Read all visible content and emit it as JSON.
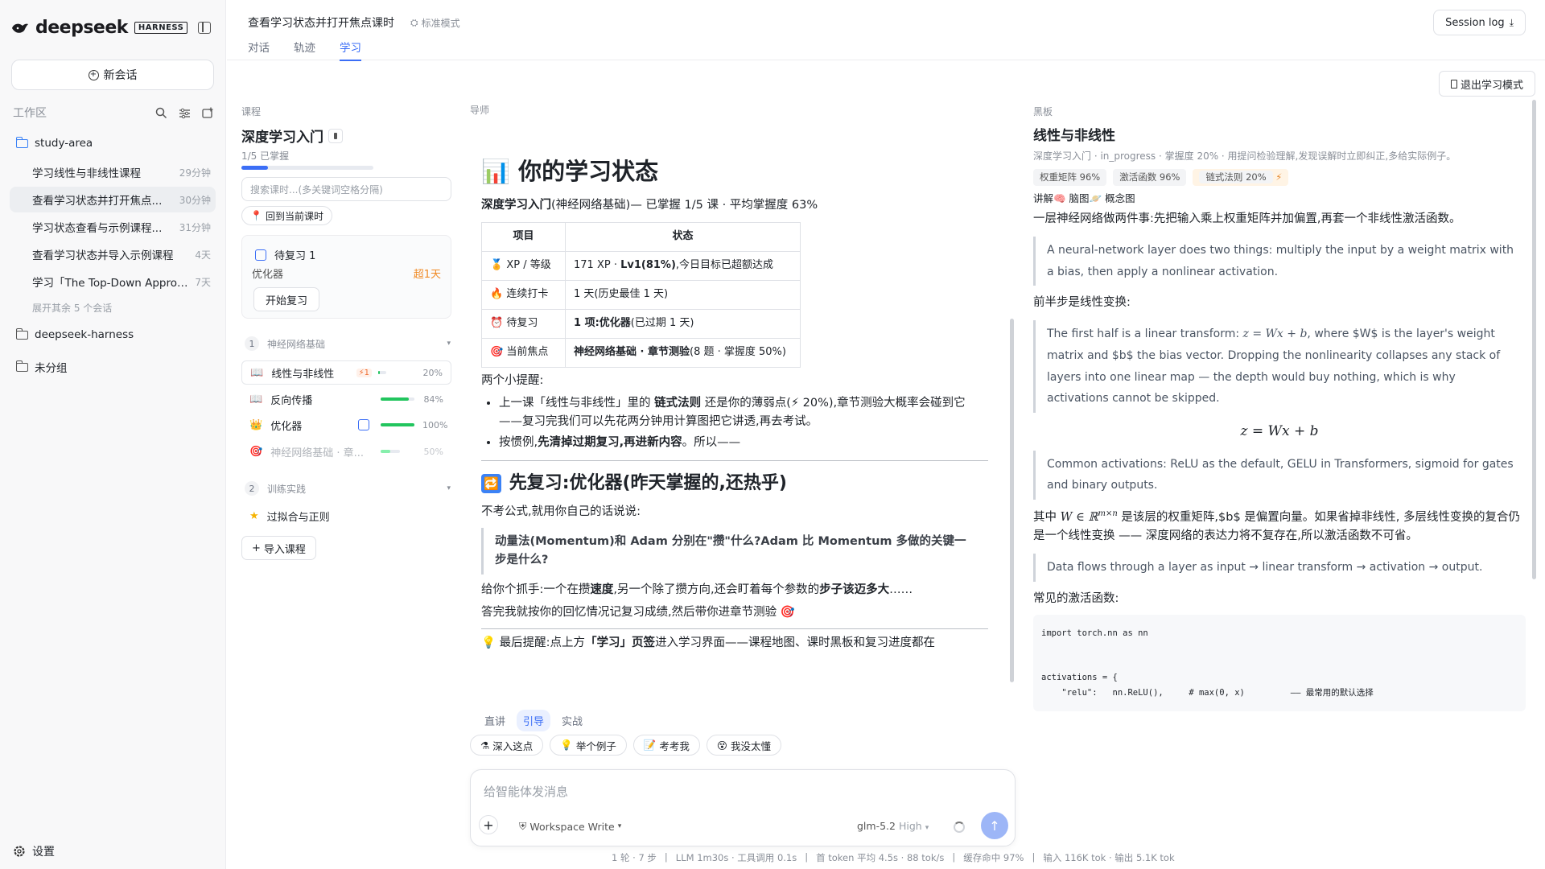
{
  "brand": {
    "name": "deepseek",
    "badge": "HARNESS"
  },
  "sidebar": {
    "new_chat": "新会话",
    "workspace_label": "工作区",
    "folders": [
      {
        "name": "study-area"
      },
      {
        "name": "deepseek-harness"
      },
      {
        "name": "未分组"
      }
    ],
    "sessions": [
      {
        "title": "学习线性与非线性课程",
        "time": "29分钟"
      },
      {
        "title": "查看学习状态并打开焦点...",
        "time": "30分钟"
      },
      {
        "title": "学习状态查看与示例课程...",
        "time": "31分钟"
      },
      {
        "title": "查看学习状态并导入示例课程",
        "time": "4天"
      },
      {
        "title": "学习「The Top-Down Approa...",
        "time": "7天"
      }
    ],
    "more": "展开其余 5 个会话",
    "settings": "设置"
  },
  "topbar": {
    "title": "查看学习状态并打开焦点课时",
    "mode": "标准模式",
    "tabs": [
      "对话",
      "轨迹",
      "学习"
    ],
    "session_log": "Session log"
  },
  "exit_study": "退出学习模式",
  "course": {
    "section": "课程",
    "title": "深度学习入门",
    "mastery_text": "1/5 已掌握",
    "mastery_fraction": 0.2,
    "search_placeholder": "搜索课时...(多关键词空格分隔)",
    "back_current": "回到当前课时",
    "review": {
      "title": "待复习 1",
      "item": "优化器",
      "overdue": "超1天",
      "button": "开始复习"
    },
    "groups": [
      {
        "num": "1",
        "name": "神经网络基础",
        "lessons": [
          {
            "name": "线性与非线性",
            "badge": "1",
            "pct": "20%",
            "progress": 0.2
          },
          {
            "name": "反向传播",
            "pct": "84%",
            "progress": 0.84
          },
          {
            "name": "优化器",
            "pct": "100%",
            "progress": 1.0
          },
          {
            "name": "神经网络基础 · 章...",
            "pct": "50%",
            "progress": 0.5
          }
        ]
      },
      {
        "num": "2",
        "name": "训练实践",
        "lessons": [
          {
            "name": "过拟合与正则"
          }
        ]
      }
    ],
    "import": "导入课程"
  },
  "tutor": {
    "label": "导师",
    "h1": "你的学习状态",
    "summary": {
      "course": "深度学习入门",
      "rest": "(神经网络基础)— 已掌握 1/5 课 · 平均掌握度 63%"
    },
    "table": {
      "headers": [
        "项目",
        "状态"
      ],
      "rows": [
        {
          "icon": "🏅",
          "k": "XP / 等级",
          "v1": "171 XP · ",
          "vb": "Lv1(81%)",
          "v2": ",今日目标已超额达成"
        },
        {
          "icon": "🔥",
          "k": "连续打卡",
          "v1": "1 天(历史最佳 1 天)",
          "vb": "",
          "v2": ""
        },
        {
          "icon": "⏰",
          "k": "待复习",
          "v1": "",
          "vb": "1 项:优化器",
          "v2": "(已过期 1 天)"
        },
        {
          "icon": "🎯",
          "k": "当前焦点",
          "v1": "",
          "vb": "神经网络基础 · 章节测验",
          "v2": "(8 题 · 掌握度 50%)"
        }
      ]
    },
    "reminder": "两个小提醒:",
    "bullet1_a": "上一课「线性与非线性」里的 ",
    "bullet1_b": "链式法则",
    "bullet1_c": " 还是你的薄弱点(⚡ 20%),章节测验大概率会碰到它——复习完我们可以先花两分钟用计算图把它讲透,再去考试。",
    "bullet2_a": "按惯例,",
    "bullet2_b": "先清掉过期复习,再进新内容",
    "bullet2_c": "。所以——",
    "h2": "先复习:优化器(昨天掌握的,还热乎)",
    "p1": "不考公式,就用你自己的话说说:",
    "quote": "动量法(Momentum)和 Adam 分别在\"攒\"什么?Adam 比 Momentum 多做的关键一步是什么?",
    "p2_a": "给你个抓手:一个在攒",
    "p2_b": "速度",
    "p2_c": ",另一个除了攒方向,还会盯着每个参数的",
    "p2_d": "步子该迈多大",
    "p2_e": "……",
    "p3": "答完我就按你的回忆情况记复习成绩,然后带你进章节测验 🎯",
    "p4_a": "💡 最后提醒:点上方",
    "p4_b": "「学习」页签",
    "p4_c": "进入学习界面——课程地图、课时黑板和复习进度都在"
  },
  "modes": [
    "直讲",
    "引导",
    "实战"
  ],
  "chips": [
    "深入这点",
    "举个例子",
    "考考我",
    "我没太懂"
  ],
  "composer": {
    "placeholder": "给智能体发消息",
    "workspace": "Workspace Write",
    "model": "glm-5.2",
    "level": "High"
  },
  "status": [
    "1 轮 · 7 步",
    "LLM 1m30s · 工具调用 0.1s",
    "首 token 平均 4.5s · 88 tok/s",
    "缓存命中 97%",
    "输入 116K tok · 输出 5.1K tok"
  ],
  "board": {
    "label": "黑板",
    "title": "线性与非线性",
    "meta": "深度学习入门 · in_progress · 掌握度 20% · 用提问检验理解,发现误解时立即纠正,多给实际例子。",
    "tags": [
      "权重矩阵 96%",
      "激活函数 96%",
      "链式法则 20%"
    ],
    "links": "讲解🧠 脑图🪐 概念图",
    "p1": "一层神经网络做两件事:先把输入乘上权重矩阵并加偏置,再套一个非线性激活函数。",
    "q1": "A neural-network layer does two things: multiply the input by a weight matrix with a bias, then apply a nonlinear activation.",
    "p2": "前半步是线性变换:",
    "q2_a": "The first half is a linear transform: ",
    "q2_m": "z = Wx + b",
    "q2_b": ", where $W$ is the layer's weight matrix and $b$ the bias vector. Dropping the nonlinearity collapses any stack of layers into one linear map — the depth would buy nothing, which is why activations cannot be skipped.",
    "formula": "z = Wx + b",
    "q3": "Common activations: ReLU as the default, GELU in Transformers, sigmoid for gates and binary outputs.",
    "p3_a": "其中 ",
    "p3_m": "W ∈ ℝ",
    "p3_sup": "m×n",
    "p3_b": " 是该层的权重矩阵,$b$ 是偏置向量。如果省掉非线性, 多层线性变换的复合仍是一个线性变换 —— 深度网络的表达力将不复存在,所以激活函数不可省。",
    "q4": "Data flows through a layer as input → linear transform → activation → output.",
    "p4": "常见的激活函数:",
    "code": "import torch.nn as nn\n\n\nactivations = {\n    \"relu\":   nn.ReLU(),     # max(0, x)         —— 最常用的默认选择"
  }
}
